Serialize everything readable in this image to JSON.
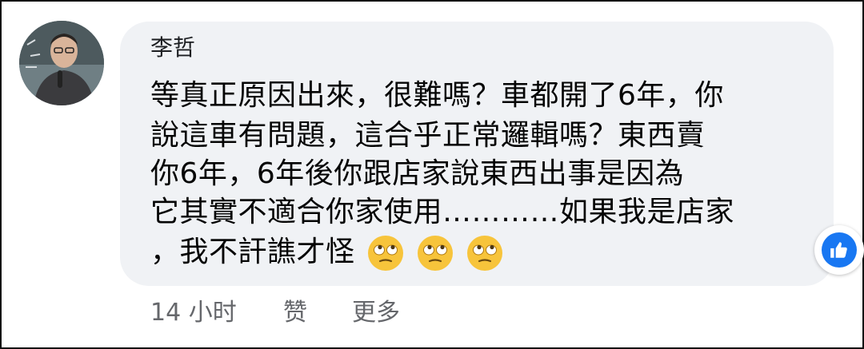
{
  "comment": {
    "author": "李哲",
    "body_lines": [
      "等真正原因出來，很難嗎？車都開了6年，你",
      "說這車有問題，這合乎正常邏輯嗎？東西賣",
      "你6年，6年後你跟店家說東西出事是因為",
      "它其實不適合你家使用…………如果我是店家",
      "，我不訐譙才怪"
    ],
    "emojis": [
      "eye-roll-emoji",
      "eye-roll-emoji",
      "eye-roll-emoji"
    ],
    "reaction": "like-icon"
  },
  "meta": {
    "time": "14 小时",
    "like_label": "赞",
    "more_label": "更多"
  },
  "colors": {
    "bubble_bg": "#f0f2f5",
    "text": "#050505",
    "meta_text": "#65676b",
    "like_blue": "#1877f2"
  }
}
